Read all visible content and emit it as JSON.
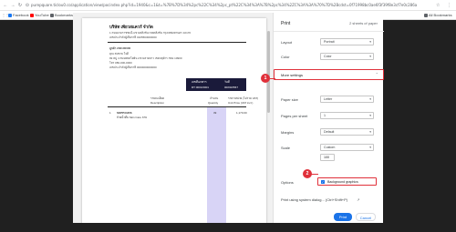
{
  "browser": {
    "url": "purepquare.ticlou0.co/application/view/pocindex.php?id=1940&c=1&t=%7B%7D%34%2pc%22C%34%2pc_pt%22C%34%3A%7B%2pc%34%2ZC%3A%3A%70%7D%2Bcdst=0f71998bc0ae6f3f39f8e3cf7e0c286a",
    "icons": {
      "apps": "apps-grid-icon",
      "menu": "kebab-menu-icon",
      "star": "star-icon"
    },
    "bookmarks": [
      {
        "label": "Facebook",
        "color": "#1877f2"
      },
      {
        "label": "YouTube",
        "color": "#ff0000"
      },
      {
        "label": "Bookmarks",
        "color": "#5f6368"
      }
    ],
    "all_bookmarks": "All Bookmarks"
  },
  "preview": {
    "company_name": "บริษัท เพียวสแควร์ จำกัด",
    "company_lines": [
      "1 ถนนบรมราชชนนี แขวงตลิ่งชัน เขตตลิ่งชัน กรุงเทพมหานคร 10170",
      "เลขประจำตัวผู้เสียภาษี 0105563000000"
    ],
    "doc_no": "ลูกค้า 230100000",
    "customer_lines": [
      "คุณ สมชาย ใจดี",
      "99 หมู่ 4 ถนนพหลโยธิน แขวงลาดยาว เขตจตุจักร กทม 10900",
      "โทร 080-000-0000",
      "เลขประจำตัวผู้เสียภาษี 0000000000000"
    ],
    "head_labels": {
      "left": "เลขที่เอกสาร",
      "right": "วันที่"
    },
    "head_values": {
      "left": "RT 0001/0001",
      "right": "00/00/2567"
    },
    "columns": {
      "desc": [
        "รายละเอียด",
        "Description"
      ],
      "qty": [
        "จำนวน",
        "Quantity"
      ],
      "price": [
        "ราคา/หน่วย (ไม่รวม VAT)",
        "Unit Price (VAT incl.)"
      ]
    },
    "row": {
      "index": "1",
      "name": "SKPP34456",
      "sub": "ถ้วยน้ำดื่ม Skin Care ลาย",
      "qty": "39",
      "price": "1,170.00"
    }
  },
  "panel": {
    "title": "Print",
    "sheets": "2 sheets of paper",
    "layout": {
      "label": "Layout",
      "value": "Portrait"
    },
    "color": {
      "label": "Color",
      "value": "Color"
    },
    "more_settings": "More settings",
    "paper_size": {
      "label": "Paper size",
      "value": "Letter"
    },
    "pages_per_sheet": {
      "label": "Pages per sheet",
      "value": "1"
    },
    "margins": {
      "label": "Margins",
      "value": "Default"
    },
    "scale": {
      "label": "Scale",
      "value": "Custom",
      "amount": "100"
    },
    "options": {
      "label": "Options",
      "checkbox_label": "Background graphics",
      "checked": true
    },
    "system_dialog": "Print using system dialog... (Ctrl+Shift+P)",
    "print_button": "Print",
    "cancel_button": "Cancel"
  },
  "badges": [
    "1",
    "2"
  ],
  "accent_color": "#1a73e8",
  "highlight_color": "#e0303a"
}
